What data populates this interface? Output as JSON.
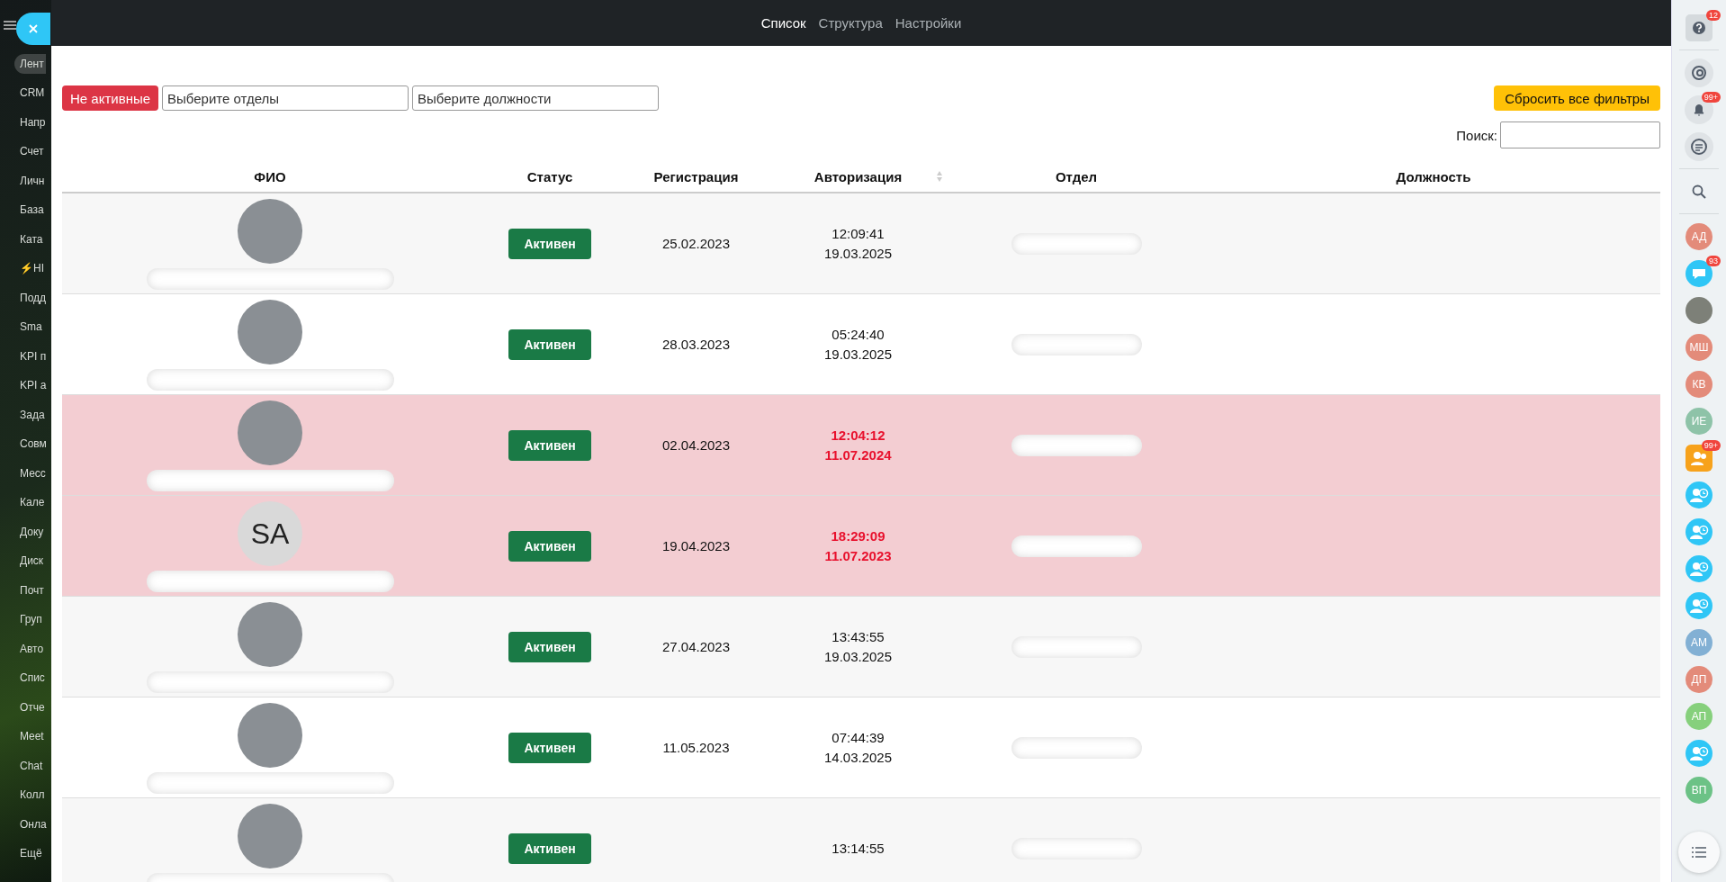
{
  "left_sidebar": {
    "items": [
      {
        "label": "Лент",
        "selected": true
      },
      {
        "label": "CRM",
        "selected": false
      },
      {
        "label": "Напр",
        "selected": false
      },
      {
        "label": "Счет",
        "selected": false
      },
      {
        "label": "Личн",
        "selected": false
      },
      {
        "label": "База",
        "selected": false
      },
      {
        "label": "Ката",
        "selected": false
      },
      {
        "label": "⚡НІ",
        "selected": false
      },
      {
        "label": "Подд",
        "selected": false
      },
      {
        "label": "Sma",
        "selected": false
      },
      {
        "label": "KPI п",
        "selected": false
      },
      {
        "label": "KPI а",
        "selected": false
      },
      {
        "label": "Зада",
        "selected": false
      },
      {
        "label": "Совм",
        "selected": false
      },
      {
        "label": "Месс",
        "selected": false
      },
      {
        "label": "Кале",
        "selected": false
      },
      {
        "label": "Доку",
        "selected": false
      },
      {
        "label": "Диск",
        "selected": false
      },
      {
        "label": "Почт",
        "selected": false
      },
      {
        "label": "Груп",
        "selected": false
      },
      {
        "label": "Авто",
        "selected": false
      },
      {
        "label": "Спис",
        "selected": false
      },
      {
        "label": "Отче",
        "selected": false
      },
      {
        "label": "Meet",
        "selected": false
      },
      {
        "label": "Chat",
        "selected": false
      },
      {
        "label": "Колл",
        "selected": false
      },
      {
        "label": "Онла",
        "selected": false
      },
      {
        "label": "Ещё",
        "selected": false
      }
    ]
  },
  "tabs": [
    {
      "label": "Список",
      "selected": true
    },
    {
      "label": "Структура",
      "selected": false
    },
    {
      "label": "Настройки",
      "selected": false
    }
  ],
  "filters": {
    "inactive_button": "Не активные",
    "departments": {
      "placeholder": "Выберите отделы"
    },
    "positions": {
      "placeholder": "Выберите должности"
    },
    "reset_button": "Сбросить все фильтры",
    "search_label": "Поиск:"
  },
  "table": {
    "columns": [
      "ФИО",
      "Статус",
      "Регистрация",
      "Авторизация",
      "Отдел",
      "Должность"
    ],
    "rows": [
      {
        "kind": "photo",
        "initials": "",
        "status": "Активен",
        "registered": "25.02.2023",
        "auth_time": "12:09:41",
        "auth_date": "19.03.2025",
        "flagged": false
      },
      {
        "kind": "photo",
        "initials": "",
        "status": "Активен",
        "registered": "28.03.2023",
        "auth_time": "05:24:40",
        "auth_date": "19.03.2025",
        "flagged": false
      },
      {
        "kind": "photo",
        "initials": "",
        "status": "Активен",
        "registered": "02.04.2023",
        "auth_time": "12:04:12",
        "auth_date": "11.07.2024",
        "flagged": true
      },
      {
        "kind": "initials",
        "initials": "SA",
        "status": "Активен",
        "registered": "19.04.2023",
        "auth_time": "18:29:09",
        "auth_date": "11.07.2023",
        "flagged": true
      },
      {
        "kind": "photo",
        "initials": "",
        "status": "Активен",
        "registered": "27.04.2023",
        "auth_time": "13:43:55",
        "auth_date": "19.03.2025",
        "flagged": false
      },
      {
        "kind": "photo",
        "initials": "",
        "status": "Активен",
        "registered": "11.05.2023",
        "auth_time": "07:44:39",
        "auth_date": "14.03.2025",
        "flagged": false
      },
      {
        "kind": "photo",
        "initials": "",
        "status": "Активен",
        "registered": "",
        "auth_time": "13:14:55",
        "auth_date": "",
        "flagged": false
      }
    ]
  },
  "right_sidebar": {
    "items": [
      {
        "kind": "help",
        "badge": "12"
      },
      {
        "kind": "divider"
      },
      {
        "kind": "copilot"
      },
      {
        "kind": "bell",
        "badge": "99+"
      },
      {
        "kind": "chats"
      },
      {
        "kind": "divider"
      },
      {
        "kind": "search"
      },
      {
        "kind": "divider"
      },
      {
        "kind": "initials",
        "text": "АД",
        "color": "#e38b7a"
      },
      {
        "kind": "chat",
        "badge": "93"
      },
      {
        "kind": "photo"
      },
      {
        "kind": "initials",
        "text": "МШ",
        "color": "#e38b7a"
      },
      {
        "kind": "initials",
        "text": "КВ",
        "color": "#e38b7a"
      },
      {
        "kind": "initials",
        "text": "ИЕ",
        "color": "#8ec3a8"
      },
      {
        "kind": "group",
        "badge": "99+"
      },
      {
        "kind": "user-clock"
      },
      {
        "kind": "user-clock"
      },
      {
        "kind": "user-clock"
      },
      {
        "kind": "user-clock"
      },
      {
        "kind": "initials",
        "text": "АМ",
        "color": "#82b0d4"
      },
      {
        "kind": "initials",
        "text": "ДП",
        "color": "#e38b7a"
      },
      {
        "kind": "initials",
        "text": "АП",
        "color": "#86d07c"
      },
      {
        "kind": "user-clock"
      },
      {
        "kind": "initials",
        "text": "ВП",
        "color": "#6cc286"
      }
    ]
  }
}
